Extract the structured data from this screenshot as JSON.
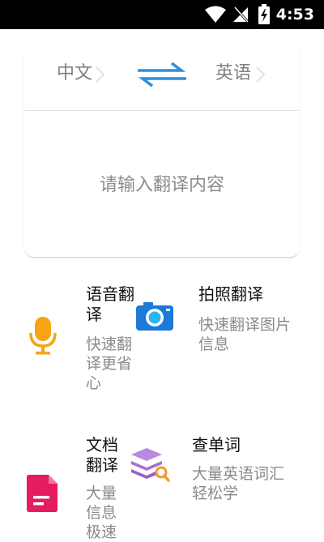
{
  "status_bar": {
    "time": "4:53",
    "icons": [
      "wifi-icon",
      "signal-off-icon",
      "battery-icon"
    ]
  },
  "translator": {
    "source_language": "中文",
    "target_language": "英语",
    "swap_icon": "swap-arrows-icon",
    "input_placeholder": "请输入翻译内容"
  },
  "features": [
    {
      "title": "语音翻译",
      "description": "快速翻译更省心",
      "icon": "microphone-icon",
      "icon_color": "#f6a416"
    },
    {
      "title": "拍照翻译",
      "description": "快速翻译图片信息",
      "icon": "camera-icon",
      "icon_color": "#1b79d8"
    },
    {
      "title": "文档翻译",
      "description": "大量信息极速",
      "icon": "document-icon",
      "icon_color": "#e51c5d"
    },
    {
      "title": "查单词",
      "description": "大量英语词汇轻松学",
      "icon": "stacked-books-search-icon",
      "icon_color": "#a770d2"
    }
  ],
  "colors": {
    "accent_blue": "#2b90e0",
    "placeholder_gray": "#8c8c8c"
  }
}
